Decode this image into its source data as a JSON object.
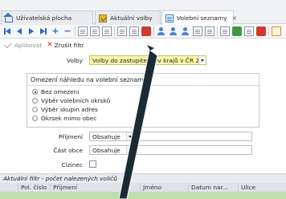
{
  "tabs": [
    {
      "label": "Uživatelská plocha",
      "icon": "home-icon",
      "active": false,
      "closable": false
    },
    {
      "label": "Aktuální volby",
      "icon": "ballot-icon",
      "active": false,
      "closable": false
    },
    {
      "label": "Volební seznamy",
      "icon": "list-icon",
      "active": true,
      "closable": true
    }
  ],
  "tab_close_glyph": "×",
  "toolbar": {
    "icons": [
      "first-record-icon",
      "previous-record-icon",
      "next-record-icon",
      "last-record-icon",
      "add-record-icon",
      "delete-record-icon",
      "grid-options-icon",
      "expand-icon",
      "columns-icon",
      "filter-icon",
      "export-icon",
      "import-icon",
      "person-icon",
      "person-add-icon",
      "person-remove-icon",
      "refresh-icon",
      "copy-icon",
      "print-preview-icon",
      "report-green-icon",
      "report-blue-icon",
      "report-red-icon",
      "print-icon"
    ]
  },
  "actions": {
    "apply_label": "Aplikovat",
    "clear_label": "Zrušit filtr"
  },
  "volby": {
    "label": "Volby",
    "value": "Volby do zastupitelstev krajů v ČR 2024"
  },
  "preview_group": {
    "title": "Omezení náhledu na volební seznam",
    "options": [
      "Bez omezení",
      "Výběr volebních okrsků",
      "Výběr skupin adres",
      "Okrsek mimo obec"
    ],
    "selected_index": 0
  },
  "fields": {
    "prijmeni_label": "Příjmení",
    "prijmeni_op": "Obsahuje",
    "cast_obce_label": "Část obce",
    "cast_obce_op": "Obsahuje",
    "cizinec_label": "Cizinec"
  },
  "filter_status": "Aktuální filtr - počet nalezených voličů",
  "grid": {
    "columns": [
      "Pol. číslo",
      "Příjmení",
      "Jméno",
      "Datum nar...",
      "Ulice"
    ]
  },
  "colors": {
    "volby_highlight": "#fdf7a8",
    "selected_row": "#bde1a9",
    "nav_blue": "#2c66c9",
    "clear_red": "#d22b2b"
  }
}
